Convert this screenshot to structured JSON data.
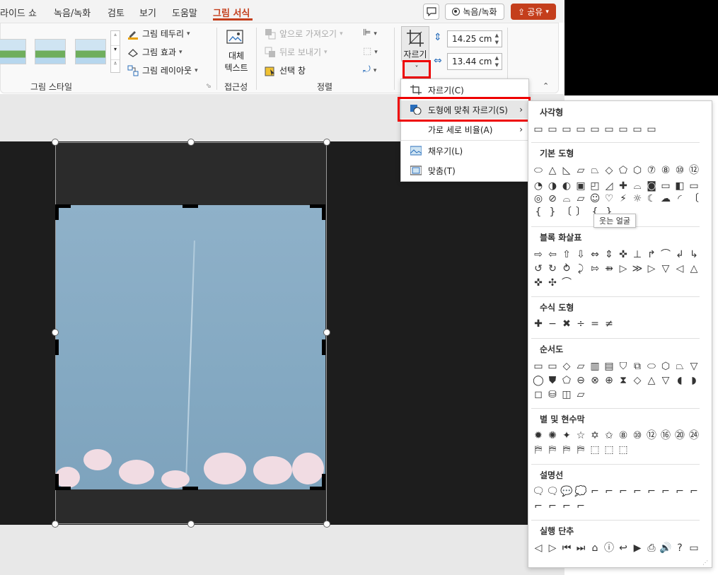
{
  "tabs": [
    "라이드 쇼",
    "녹음/녹화",
    "검토",
    "보기",
    "도움말",
    "그림 서식"
  ],
  "top_buttons": {
    "comment": "▢",
    "record": "녹음/녹화",
    "share": "공유"
  },
  "ribbon": {
    "picture_border": "그림 테두리",
    "picture_effects": "그림 효과",
    "picture_layout": "그림 레이아웃",
    "group_picture_styles": "그림 스타일",
    "alt_text_line1": "대체",
    "alt_text_line2": "텍스트",
    "group_accessibility": "접근성",
    "bring_forward": "앞으로 가져오기",
    "send_backward": "뒤로 보내기",
    "selection_pane": "선택 창",
    "group_arrange": "정렬",
    "crop_label": "자르기",
    "height_value": "14.25 cm",
    "width_value": "13.44 cm"
  },
  "crop_menu": [
    {
      "label": "자르기(C)",
      "icon": "crop-icon",
      "submenu": false
    },
    {
      "label": "도형에 맞춰 자르기(S)",
      "icon": "crop-to-shape-icon",
      "submenu": true
    },
    {
      "label": "가로 세로 비율(A)",
      "icon": "",
      "submenu": true
    },
    {
      "label": "채우기(L)",
      "icon": "fill-icon",
      "submenu": false
    },
    {
      "label": "맞춤(T)",
      "icon": "fit-icon",
      "submenu": false
    }
  ],
  "shapes_panel": {
    "sections": [
      {
        "title": "사각형",
        "rows": [
          "▭▭▭▭▭▭▭▭▭"
        ]
      },
      {
        "title": "기본 도형",
        "rows": [
          "⬭△◺▱⏢◇⬠⬡⑦⑧⑩⑫",
          "◔◑◐▣◰◿✚⌓◙▭◧▭",
          "◎⊘⌓▱☺♡⚡☼☾☁◜〔",
          "{}〔〕{}"
        ]
      },
      {
        "title": "블록 화살표",
        "rows": [
          "⇨⇦⇧⇩⇔⇕✜⊥↱⌒↲↳",
          "↺↻⥁⤸⇰⇻▷≫▷▽◁△",
          "✜✣⌒"
        ]
      },
      {
        "title": "수식 도형",
        "rows": [
          "✚−✖÷=≠"
        ]
      },
      {
        "title": "순서도",
        "rows": [
          "▭▭◇▱▥▤⛉⧉⬭⬡⏢▽",
          "◯⛊⬠⊖⊗⊕⧗◇△▽◖◗",
          "◻⛁◫▱"
        ]
      },
      {
        "title": "별 및 현수막",
        "rows": [
          "✹✺✦☆✡✩⑧⑩⑫⑯⑳㉔",
          "⛿⛿⛿⛿⬚⬚⬚"
        ]
      },
      {
        "title": "설명선",
        "rows": [
          "🗨🗨💬💭⌐⌐⌐⌐⌐⌐⌐⌐",
          "⌐⌐⌐⌐"
        ]
      },
      {
        "title": "실행 단추",
        "rows": [
          "◁▷⏮⏭⌂ⓘ↩▶⎙🔊?▭"
        ]
      }
    ],
    "tooltip": "웃는 얼굴"
  }
}
